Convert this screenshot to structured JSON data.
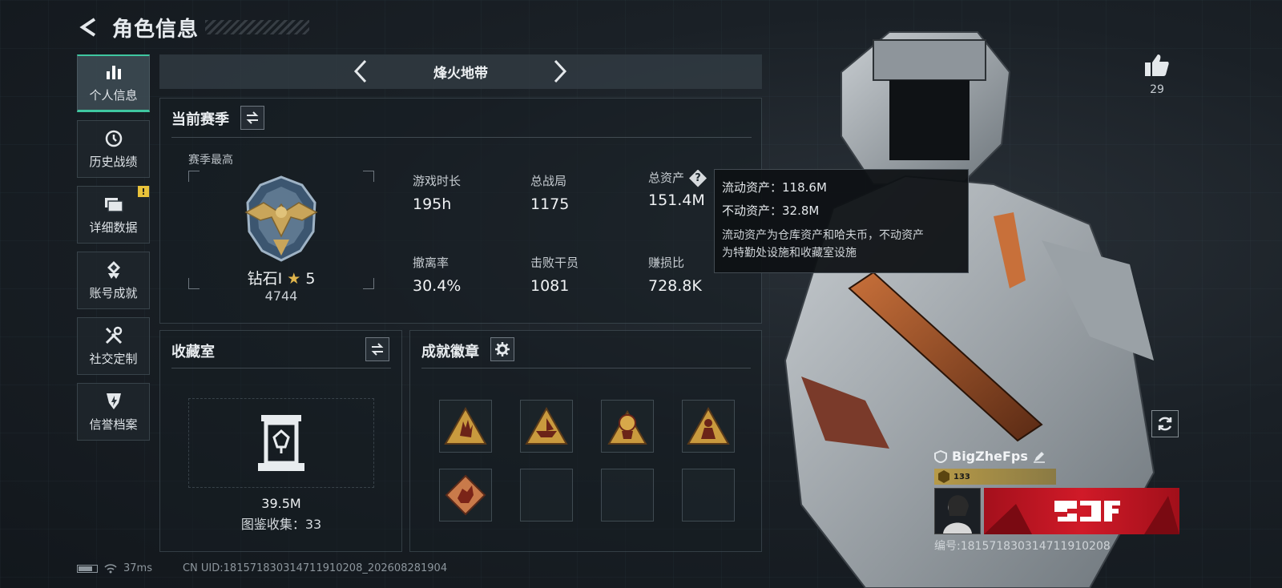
{
  "header": {
    "title": "角色信息"
  },
  "sidebar": {
    "items": [
      {
        "label": "个人信息",
        "active": true,
        "icon": "bar-chart-icon"
      },
      {
        "label": "历史战绩",
        "icon": "history-clock-icon"
      },
      {
        "label": "详细数据",
        "icon": "folder-icon",
        "badge": "!"
      },
      {
        "label": "账号成就",
        "icon": "achievement-icon"
      },
      {
        "label": "社交定制",
        "icon": "tools-icon"
      },
      {
        "label": "信誉档案",
        "icon": "shield-icon"
      }
    ]
  },
  "mode": {
    "title": "烽火地带"
  },
  "season": {
    "title": "当前赛季",
    "subtitle": "赛季最高",
    "rank_name": "钻石Ⅰ",
    "rank_stars": "5",
    "rank_score": "4744",
    "stats": [
      {
        "label": "游戏时长",
        "value": "195h"
      },
      {
        "label": "总战局",
        "value": "1175"
      },
      {
        "label": "总资产",
        "value": "151.4M"
      },
      {
        "label": "撤离率",
        "value": "30.4%"
      },
      {
        "label": "击败干员",
        "value": "1081"
      },
      {
        "label": "赚损比",
        "value": "728.8K"
      }
    ]
  },
  "tooltip": {
    "line1": "流动资产：118.6M",
    "line2": "不动资产：32.8M",
    "desc1": "流动资产为仓库资产和哈夫币，不动资产",
    "desc2": "为特勤处设施和收藏室设施"
  },
  "collection": {
    "title": "收藏室",
    "value": "39.5M",
    "count": "图鉴收集：33"
  },
  "badges": {
    "title": "成就徽章",
    "slots": [
      "hand-badge-icon",
      "boat-badge-icon",
      "trophy-badge-icon",
      "soldier-badge-icon",
      "dragon-badge-icon",
      "",
      "",
      ""
    ]
  },
  "like": {
    "count": "29"
  },
  "profile": {
    "name": "BigZheFps",
    "level": "133",
    "uid_line": "编号:1815718303147119102​08"
  },
  "status": {
    "ping": "37ms",
    "uid": "CN UID:1815718303147119102​08_202608281904"
  },
  "colors": {
    "accent": "#3fc7a0",
    "warning": "#e8c23a",
    "banner": "#d01a28"
  }
}
